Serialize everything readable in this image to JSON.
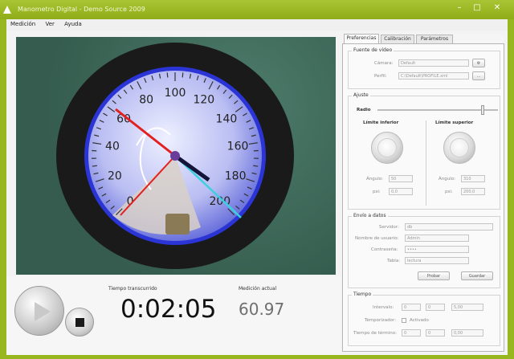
{
  "window": {
    "title": "Manometro Digital - Demo Source 2009",
    "controls": [
      "minimize",
      "maximize",
      "close"
    ]
  },
  "menu": [
    "Medición",
    "Ver",
    "Ayuda"
  ],
  "dial": {
    "ticks": [
      "0",
      "20",
      "40",
      "60",
      "80",
      "100",
      "120",
      "140",
      "160",
      "180",
      "200"
    ]
  },
  "readout": {
    "elapsed_label": "Tiempo transcurrido",
    "elapsed_value": "0:02:05",
    "measure_label": "Medición actual",
    "measure_value": "60.97"
  },
  "tabs": [
    "Preferencias",
    "Calibración",
    "Parámetros"
  ],
  "video_source": {
    "title": "Fuente de vídeo",
    "camera_label": "Cámara:",
    "camera_value": "Default",
    "profile_label": "Perfil:",
    "profile_value": "C:\\Default\\PROFILE.xml"
  },
  "adjust": {
    "title": "Ajuste",
    "radius_label": "Radio",
    "lower_title": "Límite inferior",
    "upper_title": "Límite superior",
    "lower_angle_label": "Ángulo:",
    "lower_angle_value": "50",
    "lower_psi_label": "psi:",
    "lower_psi_value": "0,0",
    "upper_angle_label": "Ángulo:",
    "upper_angle_value": "310",
    "upper_psi_label": "psi:",
    "upper_psi_value": "200,0"
  },
  "data_send": {
    "title": "Envío a datos",
    "server_label": "Servidor:",
    "server_value": "db",
    "user_label": "Nombre de usuario:",
    "user_value": "Admin",
    "password_label": "Contraseña:",
    "password_value": "••••",
    "table_label": "Tabla:",
    "table_value": "lectura",
    "connect_label": "Probar",
    "save_label": "Guardar"
  },
  "time_group": {
    "title": "Tiempo",
    "interval_label": "Intervalo:",
    "temp_label": "Temporizador:",
    "temp_check": "Activado",
    "stop_label": "Tiempo de término:",
    "interval_vals": [
      "0",
      "0",
      "5,00"
    ],
    "stop_vals": [
      "0",
      "0",
      "0,00"
    ]
  }
}
